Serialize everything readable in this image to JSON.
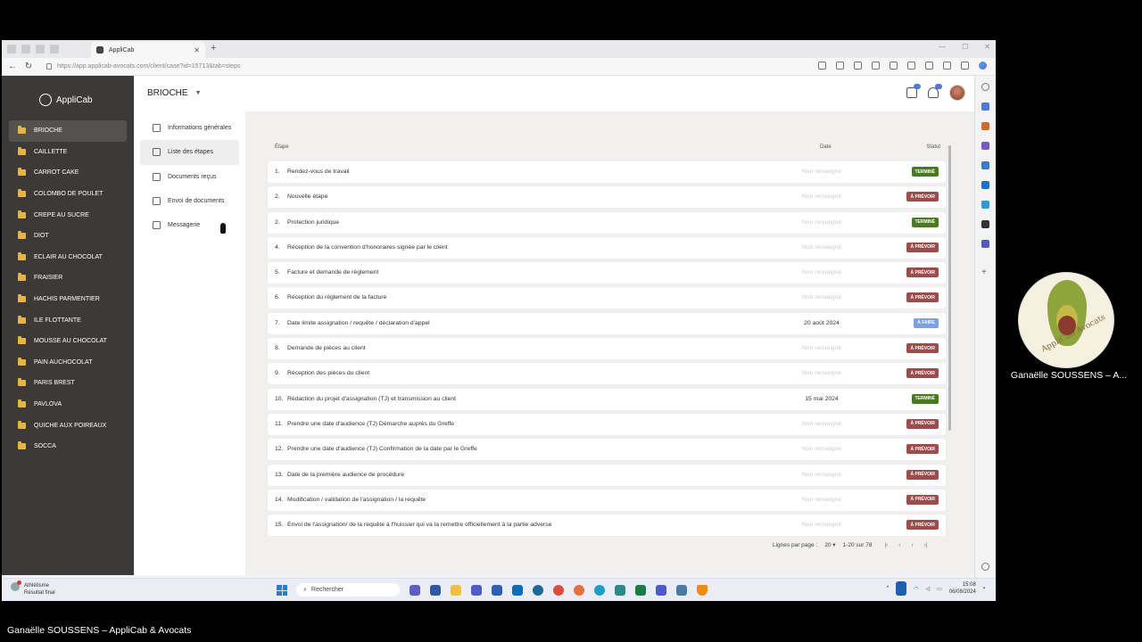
{
  "browser": {
    "tab_title": "AppliCab",
    "url": "https://app.applicab-avocats.com/client/case?id=15713&tab=steps"
  },
  "app": {
    "logo_text": "AppliCab",
    "case_title": "BRIOCHE",
    "notifications": {
      "messages_badge": "",
      "bell_badge": ""
    }
  },
  "sidebar": {
    "items": [
      {
        "label": "BRIOCHE",
        "active": true
      },
      {
        "label": "CAILLETTE",
        "active": false
      },
      {
        "label": "CARROT CAKE",
        "active": false
      },
      {
        "label": "COLOMBO DE POULET",
        "active": false
      },
      {
        "label": "CREPE AU SUCRE",
        "active": false
      },
      {
        "label": "DIOT",
        "active": false
      },
      {
        "label": "ECLAIR AU CHOCOLAT",
        "active": false
      },
      {
        "label": "FRAISIER",
        "active": false
      },
      {
        "label": "HACHIS PARMENTIER",
        "active": false
      },
      {
        "label": "ILE FLOTTANTE",
        "active": false
      },
      {
        "label": "MOUSSE AU CHOCOLAT",
        "active": false
      },
      {
        "label": "PAIN AUCHOCOLAT",
        "active": false
      },
      {
        "label": "PARIS BREST",
        "active": false
      },
      {
        "label": "PAVLOVA",
        "active": false
      },
      {
        "label": "QUICHE AUX POIREAUX",
        "active": false
      },
      {
        "label": "SOCCA",
        "active": false
      }
    ]
  },
  "subnav": {
    "items": [
      {
        "label": "Informations générales",
        "icon": "info-doc-icon",
        "active": false
      },
      {
        "label": "Liste des étapes",
        "icon": "checklist-icon",
        "active": true
      },
      {
        "label": "Documents reçus",
        "icon": "documents-icon",
        "active": false
      },
      {
        "label": "Envoi de documents",
        "icon": "send-document-icon",
        "active": false
      },
      {
        "label": "Messagerie",
        "icon": "message-icon",
        "active": false
      }
    ]
  },
  "table": {
    "headers": {
      "etape": "Étape",
      "date": "Date",
      "statut": "Statut"
    },
    "rows": [
      {
        "num": "1.",
        "label": "Rendez-vous de travail",
        "date": "Non renseigné",
        "date_set": false,
        "status": "TERMINÉ",
        "status_type": "done"
      },
      {
        "num": "2.",
        "label": "Nouvelle étape",
        "date": "Non renseigné",
        "date_set": false,
        "status": "À PRÉVOIR",
        "status_type": "plan"
      },
      {
        "num": "2.",
        "label": "Protection juridique",
        "date": "Non renseigné",
        "date_set": false,
        "status": "TERMINÉ",
        "status_type": "done"
      },
      {
        "num": "4.",
        "label": "Réception de la convention d'honoraires signée par le client",
        "date": "Non renseigné",
        "date_set": false,
        "status": "À PRÉVOIR",
        "status_type": "plan"
      },
      {
        "num": "5.",
        "label": "Facture et demande de règlement",
        "date": "Non renseigné",
        "date_set": false,
        "status": "À PRÉVOIR",
        "status_type": "plan"
      },
      {
        "num": "6.",
        "label": "Réception du règlement de la facture",
        "date": "Non renseigné",
        "date_set": false,
        "status": "À PRÉVOIR",
        "status_type": "plan"
      },
      {
        "num": "7.",
        "label": "Date limite assignation / requête / déclaration d'appel",
        "date": "20 août 2024",
        "date_set": true,
        "status": "À FAIRE",
        "status_type": "todo"
      },
      {
        "num": "8.",
        "label": "Demande de pièces au client",
        "date": "Non renseigné",
        "date_set": false,
        "status": "À PRÉVOIR",
        "status_type": "plan"
      },
      {
        "num": "9.",
        "label": "Réception des pièces du client",
        "date": "Non renseigné",
        "date_set": false,
        "status": "À PRÉVOIR",
        "status_type": "plan"
      },
      {
        "num": "10.",
        "label": "Rédaction du projet d'assignation (TJ) et transmission au client",
        "date": "15 mai 2024",
        "date_set": true,
        "status": "TERMINÉ",
        "status_type": "done"
      },
      {
        "num": "11.",
        "label": "Prendre une date d'audience (TJ) Démarche auprès du Greffe",
        "date": "Non renseigné",
        "date_set": false,
        "status": "À PRÉVOIR",
        "status_type": "plan"
      },
      {
        "num": "12.",
        "label": "Prendre une date d'audience (TJ) Confirmation de la date par le Greffe",
        "date": "Non renseigné",
        "date_set": false,
        "status": "À PRÉVOIR",
        "status_type": "plan"
      },
      {
        "num": "13.",
        "label": "Date de la première audience de procédure",
        "date": "Non renseigné",
        "date_set": false,
        "status": "À PRÉVOIR",
        "status_type": "plan"
      },
      {
        "num": "14.",
        "label": "Modification / validation de l'assignation / la requête",
        "date": "Non renseigné",
        "date_set": false,
        "status": "À PRÉVOIR",
        "status_type": "plan"
      },
      {
        "num": "15.",
        "label": "Envoi de l'assignation/ de la requête à l'huissier qui va la remettre officiellement à la partie adverse",
        "date": "Non renseigné",
        "date_set": false,
        "status": "À PRÉVOIR",
        "status_type": "plan"
      }
    ]
  },
  "pagination": {
    "rows_per_page_label": "Lignes par page :",
    "rows_per_page": "20",
    "range": "1-20 sur 78"
  },
  "status_colors": {
    "done": "#4a7a1e",
    "plan": "#9e4b4b",
    "todo": "#7aa0e8"
  },
  "taskbar": {
    "weather_title": "Athlétisme",
    "weather_sub": "Résultat final",
    "search_placeholder": "Rechercher",
    "time": "15:08",
    "date": "06/08/2024"
  },
  "participant": {
    "avatar_text": "AppliCab Avocats",
    "name": "Ganaëlle SOUSSENS – A..."
  },
  "caption": "Ganaëlle SOUSSENS – AppliCab & Avocats"
}
